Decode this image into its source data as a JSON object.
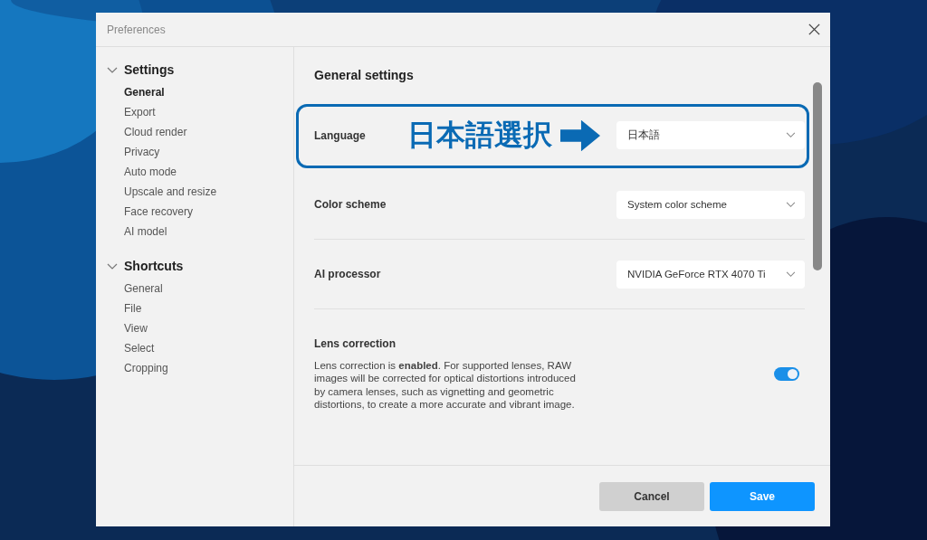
{
  "window": {
    "title": "Preferences"
  },
  "sidebar": {
    "sections": [
      {
        "title": "Settings",
        "expanded": true,
        "items": [
          {
            "label": "General",
            "selected": true
          },
          {
            "label": "Export",
            "selected": false
          },
          {
            "label": "Cloud render",
            "selected": false
          },
          {
            "label": "Privacy",
            "selected": false
          },
          {
            "label": "Auto mode",
            "selected": false
          },
          {
            "label": "Upscale and resize",
            "selected": false
          },
          {
            "label": "Face recovery",
            "selected": false
          },
          {
            "label": "AI model",
            "selected": false
          }
        ]
      },
      {
        "title": "Shortcuts",
        "expanded": true,
        "items": [
          {
            "label": "General",
            "selected": false
          },
          {
            "label": "File",
            "selected": false
          },
          {
            "label": "View",
            "selected": false
          },
          {
            "label": "Select",
            "selected": false
          },
          {
            "label": "Cropping",
            "selected": false
          }
        ]
      }
    ]
  },
  "content": {
    "heading": "General settings",
    "rows": [
      {
        "kind": "select",
        "label": "Language",
        "value": "日本語",
        "annotation": "日本語選択"
      },
      {
        "kind": "select",
        "label": "Color scheme",
        "value": "System color scheme"
      },
      {
        "kind": "select",
        "label": "AI processor",
        "value": "NVIDIA GeForce RTX 4070 Ti"
      },
      {
        "kind": "toggle",
        "label": "Lens correction",
        "description": "Lens correction is **enabled**. For supported lenses, RAW images will be corrected for optical distortions introduced by camera lenses, such as vignetting and geometric distortions, to create a more accurate and vibrant image.",
        "on": true
      }
    ]
  },
  "buttons": [
    {
      "kind": "secondary",
      "label": "Cancel"
    },
    {
      "kind": "primary",
      "label": "Save"
    }
  ]
}
